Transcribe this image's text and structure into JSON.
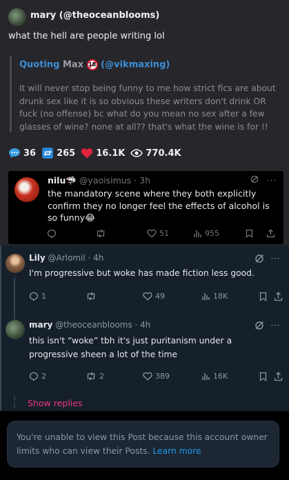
{
  "post": {
    "author": "mary (@theoceanblooms)",
    "text": "what the hell are people writing lol",
    "quote": {
      "prefix": "Quoting",
      "name": "Max",
      "badge": "18",
      "handle": "(@vikmaxing)",
      "text": "It will never stop being funny to me how strict fics are about drunk sex like it is so obvious these writers don't drink OR fuck (no offense) bc what do you mean no sex after a few glasses of wine? none at all?? that's what the wine is for !!"
    },
    "stats": {
      "replies": "36",
      "reposts": "265",
      "likes": "16.1K",
      "views": "770.4K"
    }
  },
  "embed": {
    "name": "nilu🦈",
    "handle": "@yaoisimus · 3h",
    "text": "the mandatory scene where they both explicitly confirm they no longer feel the effects of alcohol is so funny😂",
    "likes": "51",
    "views": "955"
  },
  "replies": [
    {
      "name": "Lily",
      "meta": "@Arlomil · 4h",
      "text": "I'm progressive but woke has made fiction less good.",
      "replies": "1",
      "reposts": "",
      "likes": "49",
      "views": "18K"
    },
    {
      "name": "mary",
      "meta": "@theoceanblooms · 4h",
      "text": "this isn't “woke” tbh it's just puritanism under a progressive sheen a lot of the time",
      "replies": "2",
      "reposts": "2",
      "likes": "389",
      "views": "16K"
    }
  ],
  "show_replies": "Show replies",
  "notice": {
    "text": "You're unable to view this Post because this account owner limits who can view their Posts.",
    "link": "Learn more"
  },
  "colors": {
    "accent": "#1d9bf0",
    "show_replies": "#f0357a",
    "quote_link": "#3d8fd6"
  }
}
